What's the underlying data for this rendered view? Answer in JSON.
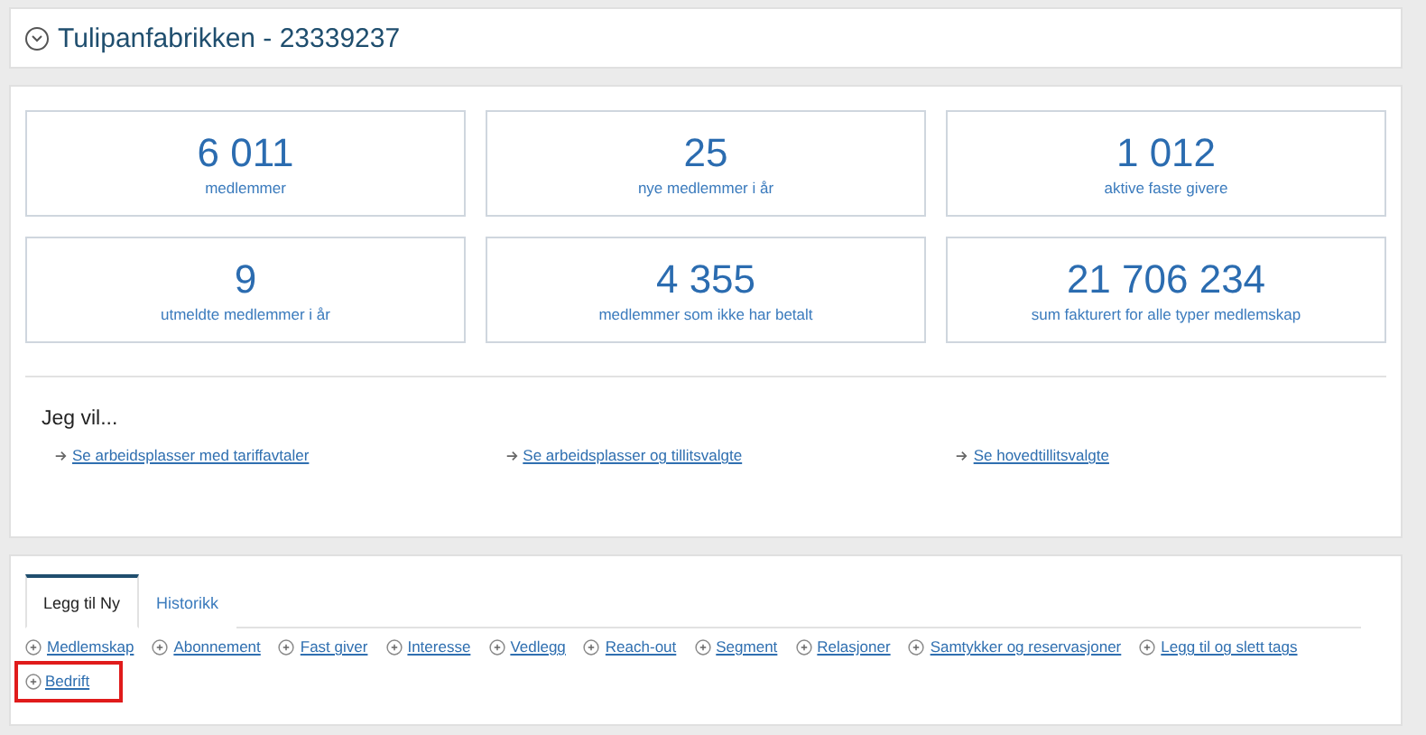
{
  "header": {
    "title": "Tulipanfabrikken - 23339237",
    "expanded": true
  },
  "stats": [
    {
      "value": "6 011",
      "label": "medlemmer"
    },
    {
      "value": "25",
      "label": "nye medlemmer i år"
    },
    {
      "value": "1 012",
      "label": "aktive faste givere"
    },
    {
      "value": "9",
      "label": "utmeldte medlemmer i år"
    },
    {
      "value": "4 355",
      "label": "medlemmer som ikke har betalt"
    },
    {
      "value": "21 706 234",
      "label": "sum fakturert for alle typer medlemskap"
    }
  ],
  "shortcuts": {
    "heading": "Jeg vil...",
    "links": [
      "Se arbeidsplasser med tariffavtaler",
      "Se arbeidsplasser og tillitsvalgte",
      "Se hovedtillitsvalgte"
    ]
  },
  "tabs": [
    {
      "label": "Legg til Ny",
      "selected": true
    },
    {
      "label": "Historikk",
      "selected": false
    }
  ],
  "actions": [
    {
      "label": "Medlemskap",
      "highlighted": false
    },
    {
      "label": "Abonnement",
      "highlighted": false
    },
    {
      "label": "Fast giver",
      "highlighted": false
    },
    {
      "label": "Interesse",
      "highlighted": false
    },
    {
      "label": "Vedlegg",
      "highlighted": false
    },
    {
      "label": "Reach-out",
      "highlighted": false
    },
    {
      "label": "Segment",
      "highlighted": false
    },
    {
      "label": "Relasjoner",
      "highlighted": false
    },
    {
      "label": "Samtykker og reservasjoner",
      "highlighted": false
    },
    {
      "label": "Legg til og slett tags",
      "highlighted": false
    },
    {
      "label": "Bedrift",
      "highlighted": true
    }
  ]
}
